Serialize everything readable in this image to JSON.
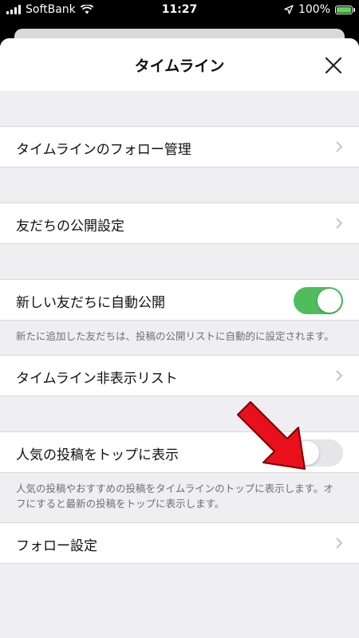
{
  "status_bar": {
    "carrier": "SoftBank",
    "time": "11:27",
    "battery": "100%",
    "battery_level": 1.0
  },
  "header": {
    "title": "タイムライン"
  },
  "settings": {
    "follow_management": {
      "label": "タイムラインのフォロー管理"
    },
    "friend_publicity": {
      "label": "友だちの公開設定"
    },
    "auto_publish": {
      "label": "新しい友だちに自動公開",
      "enabled": true,
      "note": "新たに追加した友だちは、投稿の公開リストに自動的に設定されます。"
    },
    "hidden_list": {
      "label": "タイムライン非表示リスト"
    },
    "popular_top": {
      "label": "人気の投稿をトップに表示",
      "enabled": false,
      "note": "人気の投稿やおすすめの投稿をタイムラインのトップに表示します。オフにすると最新の投稿をトップに表示します。"
    },
    "follow_settings": {
      "label": "フォロー設定"
    }
  },
  "colors": {
    "toggle_on": "#4fbd5c",
    "toggle_off": "#e6e6ea",
    "annotation_arrow": "#e8101a"
  }
}
